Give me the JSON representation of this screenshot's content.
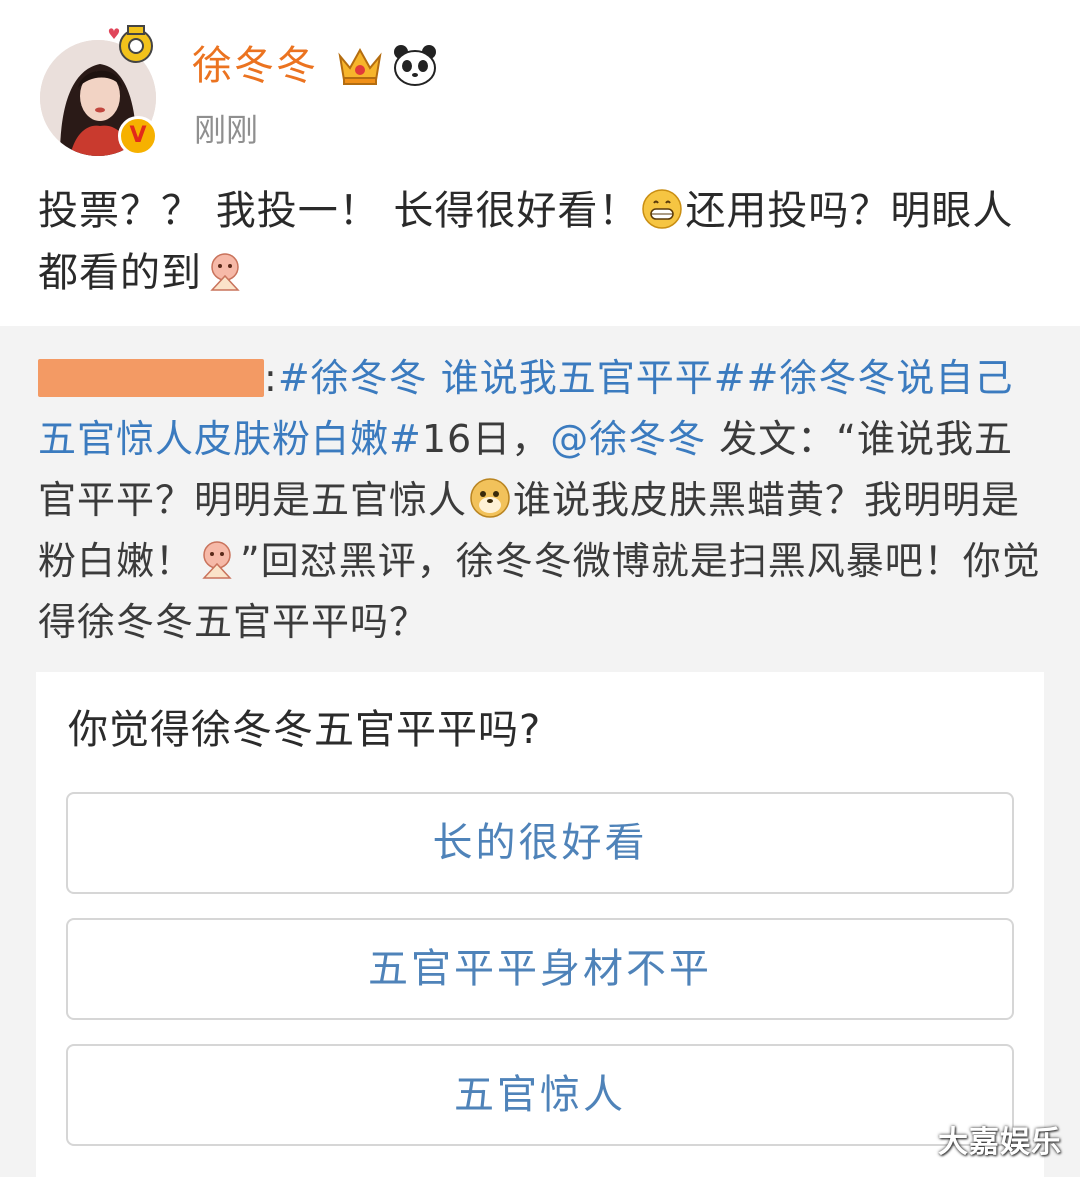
{
  "post": {
    "username": "徐冬冬",
    "timestamp": "刚刚",
    "text_part1": "投票？？  我投一！  长得很好看！",
    "text_part2": "还用投吗？明眼人都看的到",
    "emojis": [
      "grin-emoji",
      "lucky-fan-emoji"
    ]
  },
  "repost": {
    "tail1": ":",
    "hashtag1": "#徐冬冬 谁说我五官平平#",
    "hashtag2": "#徐冬冬说自己五官惊人皮肤粉白嫩#",
    "text1": "16日，",
    "mention": "@徐冬冬",
    "text2": " 发文：“谁说我五官平平？明明是五官惊人",
    "text3": "谁说我皮肤黑蜡黄？我明明是粉白嫩！",
    "text4": "”回怼黑评，徐冬冬微博就是扫黑风暴吧！你觉得徐冬冬五官平平吗？"
  },
  "poll": {
    "question": "你觉得徐冬冬五官平平吗?",
    "options": [
      "长的很好看",
      "五官平平身材不平",
      "五官惊人"
    ]
  },
  "badge": {
    "verified_letter": "V"
  },
  "watermark": "大嘉娱乐",
  "colors": {
    "username": "#eb7320",
    "link": "#3b7bbf",
    "option_text": "#4f83b9"
  }
}
